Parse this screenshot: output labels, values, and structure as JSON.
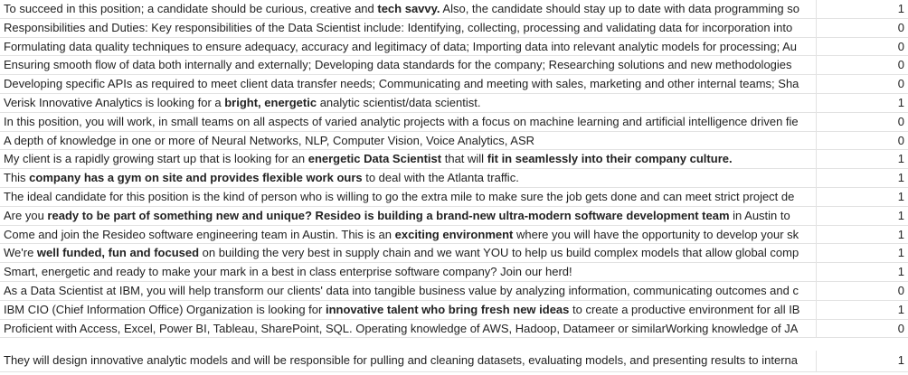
{
  "rows": [
    {
      "segments": [
        {
          "t": "To succeed in this position; a candidate should be curious, creative and ",
          "b": false
        },
        {
          "t": "tech savvy.",
          "b": true
        },
        {
          "t": " Also, the candidate should stay up to date with data programming so",
          "b": false
        }
      ],
      "label": "1"
    },
    {
      "segments": [
        {
          "t": "Responsibilities and Duties: Key responsibilities of the Data Scientist include: Identifying, collecting, processing and validating data for incorporation into",
          "b": false
        }
      ],
      "label": "0"
    },
    {
      "segments": [
        {
          "t": "Formulating data quality techniques to ensure adequacy, accuracy and legitimacy of data; Importing data into relevant analytic models for processing; Au",
          "b": false
        }
      ],
      "label": "0"
    },
    {
      "segments": [
        {
          "t": "Ensuring smooth flow of data both internally and externally; Developing data standards for the company; Researching solutions and new methodologies",
          "b": false
        }
      ],
      "label": "0"
    },
    {
      "segments": [
        {
          "t": "Developing specific APIs as required to meet client data transfer needs; Communicating and meeting with sales, marketing and other internal teams; Sha",
          "b": false
        }
      ],
      "label": "0"
    },
    {
      "segments": [
        {
          "t": "Verisk Innovative Analytics is looking for a ",
          "b": false
        },
        {
          "t": "bright, energetic",
          "b": true
        },
        {
          "t": " analytic scientist/data scientist.",
          "b": false
        }
      ],
      "label": "1"
    },
    {
      "segments": [
        {
          "t": "In this position, you will work, in small teams on all aspects of varied analytic projects with a focus on machine learning and artificial intelligence driven fie",
          "b": false
        }
      ],
      "label": "0"
    },
    {
      "segments": [
        {
          "t": "A depth of knowledge in one or more of Neural Networks, NLP, Computer Vision, Voice Analytics, ASR",
          "b": false
        }
      ],
      "label": "0"
    },
    {
      "segments": [
        {
          "t": "My client is a rapidly growing start up that is looking for an ",
          "b": false
        },
        {
          "t": "energetic Data Scientist",
          "b": true
        },
        {
          "t": " that will ",
          "b": false
        },
        {
          "t": "fit in seamlessly into their company culture.",
          "b": true
        }
      ],
      "label": "1"
    },
    {
      "segments": [
        {
          "t": "This ",
          "b": false
        },
        {
          "t": "company has a gym on site and provides flexible work ours",
          "b": true
        },
        {
          "t": " to deal with the Atlanta traffic.",
          "b": false
        }
      ],
      "label": "1"
    },
    {
      "segments": [
        {
          "t": "The ideal candidate for this position is the kind of person who is willing to go the extra mile to make sure the job gets done and can meet strict project de",
          "b": false
        }
      ],
      "label": "1"
    },
    {
      "segments": [
        {
          "t": "Are you ",
          "b": false
        },
        {
          "t": "ready to be part of something new and unique? Resideo is building a brand-new ultra-modern software development team",
          "b": true
        },
        {
          "t": " in Austin to",
          "b": false
        }
      ],
      "label": "1"
    },
    {
      "segments": [
        {
          "t": "Come and join the Resideo software engineering team in Austin. This is an ",
          "b": false
        },
        {
          "t": "exciting environment",
          "b": true
        },
        {
          "t": " where you will have the opportunity to develop your sk",
          "b": false
        }
      ],
      "label": "1"
    },
    {
      "segments": [
        {
          "t": "We're ",
          "b": false
        },
        {
          "t": "well funded, fun and focused",
          "b": true
        },
        {
          "t": " on building the very best in supply chain and we want YOU to help us build complex models that allow global comp",
          "b": false
        }
      ],
      "label": "1"
    },
    {
      "segments": [
        {
          "t": "Smart, energetic and ready to make your mark in a best in class enterprise software company? Join our herd!",
          "b": false
        }
      ],
      "label": "1"
    },
    {
      "segments": [
        {
          "t": "As a Data Scientist at IBM, you will help transform our clients' data into tangible business value by analyzing information, communicating outcomes and c",
          "b": false
        }
      ],
      "label": "0"
    },
    {
      "segments": [
        {
          "t": "IBM CIO (Chief Information Office) Organization is looking for ",
          "b": false
        },
        {
          "t": "innovative talent who bring fresh new ideas",
          "b": true
        },
        {
          "t": " to create a productive environment for all IB",
          "b": false
        }
      ],
      "label": "1"
    },
    {
      "segments": [
        {
          "t": "Proficient with Access, Excel, Power BI, Tableau, SharePoint, SQL. Operating knowledge of AWS, Hadoop, Datameer or similarWorking knowledge of JA",
          "b": false
        }
      ],
      "label": "0"
    },
    {
      "segments": [
        {
          "t": "They will design innovative analytic models and will be responsible for pulling and cleaning datasets, evaluating models, and presenting results to interna",
          "b": false
        }
      ],
      "label": "1",
      "tall": true
    }
  ]
}
